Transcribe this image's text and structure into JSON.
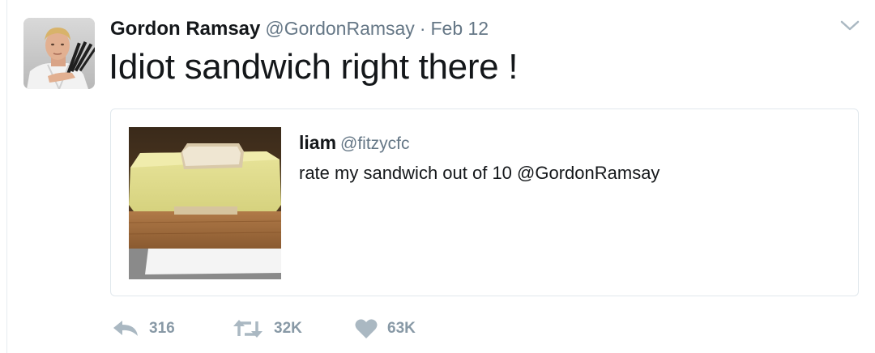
{
  "tweet": {
    "author_name": "Gordon Ramsay",
    "author_handle": "@GordonRamsay",
    "separator": "·",
    "date": "Feb 12",
    "text": "Idiot sandwich right there !"
  },
  "quoted_tweet": {
    "author_name": "liam",
    "author_handle": "@fitzycfc",
    "text": "rate my sandwich out of 10 @GordonRamsay"
  },
  "actions": {
    "reply_count": "316",
    "retweet_count": "32K",
    "like_count": "63K"
  },
  "icons": {
    "reply": "reply-icon",
    "retweet": "retweet-icon",
    "like": "heart-icon",
    "menu": "chevron-down-icon"
  },
  "colors": {
    "text": "#14171a",
    "secondary": "#657786",
    "action_gray": "#8899a6",
    "border": "#e1e8ed"
  }
}
